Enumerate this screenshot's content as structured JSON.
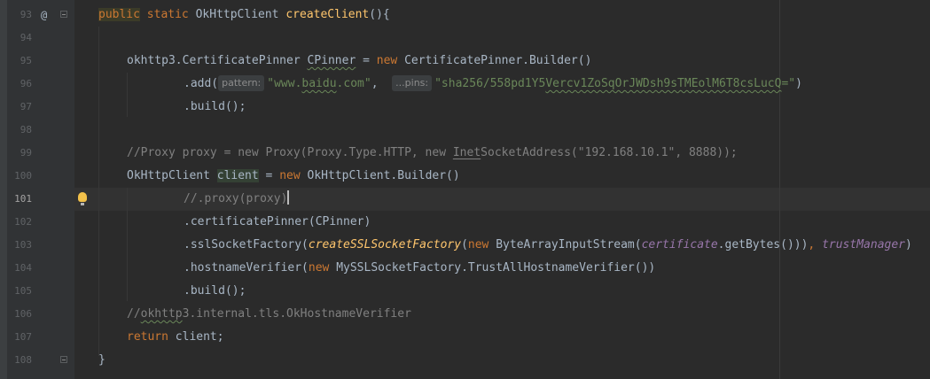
{
  "editor": {
    "lines": [
      {
        "num": "93"
      },
      {
        "num": "94"
      },
      {
        "num": "95"
      },
      {
        "num": "96"
      },
      {
        "num": "97"
      },
      {
        "num": "98"
      },
      {
        "num": "99"
      },
      {
        "num": "100"
      },
      {
        "num": "101"
      },
      {
        "num": "102"
      },
      {
        "num": "103"
      },
      {
        "num": "104"
      },
      {
        "num": "105"
      },
      {
        "num": "106"
      },
      {
        "num": "107"
      },
      {
        "num": "108"
      }
    ],
    "tokens": {
      "l93": [
        "public",
        " ",
        "static",
        " OkHttpClient ",
        "createClient",
        "(){"
      ],
      "l95": [
        "okhttp3.CertificatePinner ",
        "CPinner",
        " = ",
        "new",
        " CertificatePinner.Builder()"
      ],
      "l96": [
        ".add(",
        "pattern:",
        "\"www.",
        "baidu",
        ".com\"",
        ",  ",
        "...pins:",
        "\"sha256/558pd1Y5",
        "Vercv1ZoSqOrJWDsh9sTMEolM6T8csLucQ",
        "=\"",
        ")"
      ],
      "l97": [
        ".build();"
      ],
      "l99": [
        "//Proxy proxy = new Proxy(Proxy.Type.HTTP, new ",
        "Inet",
        "SocketAddress(\"192.168.10.1\", 8888));"
      ],
      "l100": [
        "OkHttpClient ",
        "client",
        " = ",
        "new",
        " OkHttpClient.Builder()"
      ],
      "l101": [
        "//.proxy(proxy)"
      ],
      "l102": [
        ".certificatePinner(CPinner)"
      ],
      "l103": [
        ".sslSocketFactory(",
        "createSSLSocketFactory",
        "(",
        "new",
        " ByteArrayInputStream(",
        "certificate",
        ".getBytes()))",
        ", ",
        "trustManager",
        ")"
      ],
      "l104": [
        ".hostnameVerifier(",
        "new",
        " MySSLSocketFactory.TrustAllHostnameVerifier())"
      ],
      "l105": [
        ".build();"
      ],
      "l106": [
        "//",
        "okhttp",
        "3.internal.tls.OkHostnameVerifier"
      ],
      "l107": [
        "return",
        " client;"
      ],
      "l108": [
        "}"
      ]
    },
    "gutter_marks": {
      "override_symbol": "@"
    }
  },
  "colors": {
    "background": "#2b2b2b",
    "gutter": "#313335",
    "keyword": "#cc7832",
    "method": "#ffc66d",
    "string": "#6a8759",
    "comment": "#808080",
    "field": "#9876aa",
    "default": "#a9b7c6"
  },
  "icons": [
    "override-at-icon",
    "fold-icon",
    "lightbulb-icon"
  ]
}
